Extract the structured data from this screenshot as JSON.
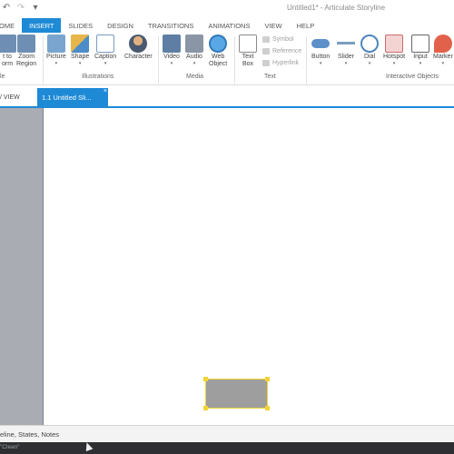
{
  "app": {
    "title": "Untitled1* - Articulate Storyline"
  },
  "quick_access": {
    "undo_icon": "undo-icon",
    "redo_icon": "redo-icon",
    "customize_icon": "customize-icon"
  },
  "ribbon_tabs": [
    "OME",
    "INSERT",
    "SLIDES",
    "DESIGN",
    "TRANSITIONS",
    "ANIMATIONS",
    "VIEW",
    "HELP"
  ],
  "active_tab": "INSERT",
  "ribbon": {
    "items": [
      {
        "label1": "t to",
        "label2": "orm",
        "icon": "transform-icon"
      },
      {
        "label1": "Zoom",
        "label2": "Region",
        "icon": "zoom-region-icon"
      },
      {
        "label1": "Picture",
        "label2": "▾",
        "icon": "picture-icon"
      },
      {
        "label1": "Shape",
        "label2": "▾",
        "icon": "shape-icon"
      },
      {
        "label1": "Caption",
        "label2": "▾",
        "icon": "caption-icon"
      },
      {
        "label1": "Character",
        "label2": "",
        "icon": "character-icon"
      },
      {
        "label1": "Video",
        "label2": "▾",
        "icon": "video-icon"
      },
      {
        "label1": "Audio",
        "label2": "▾",
        "icon": "audio-icon"
      },
      {
        "label1": "Web",
        "label2": "Object",
        "icon": "web-object-icon"
      },
      {
        "label1": "Text",
        "label2": "Box",
        "icon": "text-box-icon"
      },
      {
        "label1": "Button",
        "label2": "▾",
        "icon": "button-icon"
      },
      {
        "label1": "Slider",
        "label2": "▾",
        "icon": "slider-icon"
      },
      {
        "label1": "Dial",
        "label2": "▾",
        "icon": "dial-icon"
      },
      {
        "label1": "Hotspot",
        "label2": "▾",
        "icon": "hotspot-icon"
      },
      {
        "label1": "Input",
        "label2": "▾",
        "icon": "input-icon"
      },
      {
        "label1": "Marker",
        "label2": "▾",
        "icon": "marker-icon"
      }
    ],
    "text_commands": [
      "Symbol",
      "Reference",
      "Hyperlink"
    ],
    "groups": {
      "g1": "le",
      "illustrations": "Illustrations",
      "media": "Media",
      "text": "Text",
      "interactive": "Interactive Objects"
    }
  },
  "story_view_label": "/ VIEW",
  "doc_tab": {
    "label": "1.1 Untitled Sli...",
    "close": "×"
  },
  "status_text": "eline, States, Notes",
  "bottom_text": "\"Clean\""
}
